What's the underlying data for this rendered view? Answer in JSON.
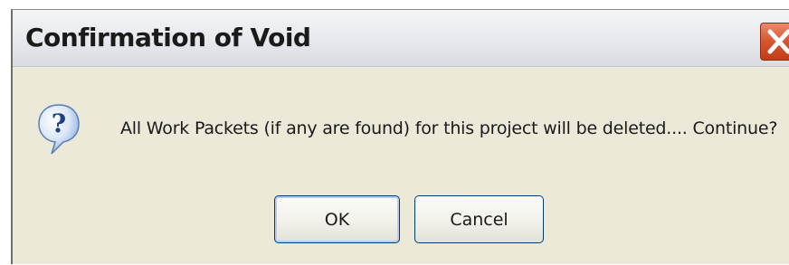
{
  "dialog": {
    "title": "Confirmation of Void",
    "message": "All Work Packets (if any are found) for this project will be deleted.... Continue?",
    "icon": "question-icon",
    "close_icon": "close-icon",
    "buttons": {
      "ok_label": "OK",
      "cancel_label": "Cancel"
    }
  },
  "colors": {
    "close_button": "#d5552f",
    "dialog_background": "#ece9d8",
    "button_border": "#003c74"
  }
}
